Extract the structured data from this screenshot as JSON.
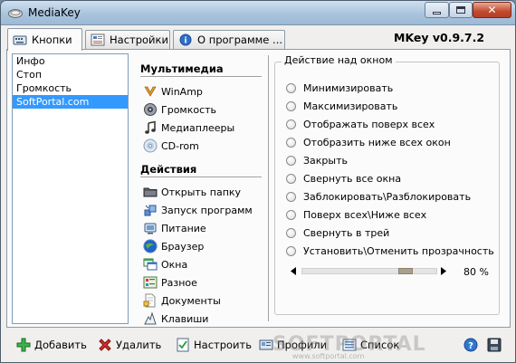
{
  "window": {
    "title": "MediaKey"
  },
  "tabs": [
    {
      "label": "Кнопки",
      "icon": "keyboard-icon",
      "active": true
    },
    {
      "label": "Настройки",
      "icon": "settings-icon",
      "active": false
    },
    {
      "label": "О программе ...",
      "icon": "info-icon",
      "active": false
    }
  ],
  "version": "MKey v0.9.7.2",
  "list": {
    "items": [
      "Инфо",
      "Стоп",
      "Громкость",
      "SoftPortal.com"
    ],
    "selected_index": 3
  },
  "categories": {
    "multimedia_title": "Мультимедиа",
    "multimedia": [
      {
        "label": "WinAmp",
        "icon": "winamp-icon"
      },
      {
        "label": "Громкость",
        "icon": "speaker-icon"
      },
      {
        "label": "Медиаплееры",
        "icon": "music-note-icon"
      },
      {
        "label": "CD-rom",
        "icon": "cd-icon"
      }
    ],
    "actions_title": "Действия",
    "actions": [
      {
        "label": "Открыть папку",
        "icon": "folder-icon"
      },
      {
        "label": "Запуск программ",
        "icon": "programs-icon"
      },
      {
        "label": "Питание",
        "icon": "power-icon"
      },
      {
        "label": "Браузер",
        "icon": "browser-icon"
      },
      {
        "label": "Окна",
        "icon": "windows-icon"
      },
      {
        "label": "Разное",
        "icon": "misc-icon"
      },
      {
        "label": "Документы",
        "icon": "documents-icon"
      },
      {
        "label": "Клавиши",
        "icon": "keys-icon"
      }
    ]
  },
  "window_action": {
    "legend": "Действие над окном",
    "options": [
      "Минимизировать",
      "Максимизировать",
      "Отображать поверх всех",
      "Отобразить ниже всех окон",
      "Закрыть",
      "Свернуть все окна",
      "Заблокировать\\Разблокировать",
      "Поверх всех\\Ниже всех",
      "Свернуть в трей",
      "Установить\\Отменить прозрачность"
    ],
    "transparency_value": 80,
    "transparency_label": "80 %"
  },
  "bottom": {
    "add": "Добавить",
    "delete": "Удалить",
    "configure": "Настроить",
    "profile": "Профили",
    "list": "Список"
  },
  "watermark": {
    "text": "SOFTPORTAL",
    "url": "www.softportal.com"
  },
  "colors": {
    "selection": "#3399ff",
    "titlebar": "#a9c4de",
    "close": "#c24a2e"
  }
}
